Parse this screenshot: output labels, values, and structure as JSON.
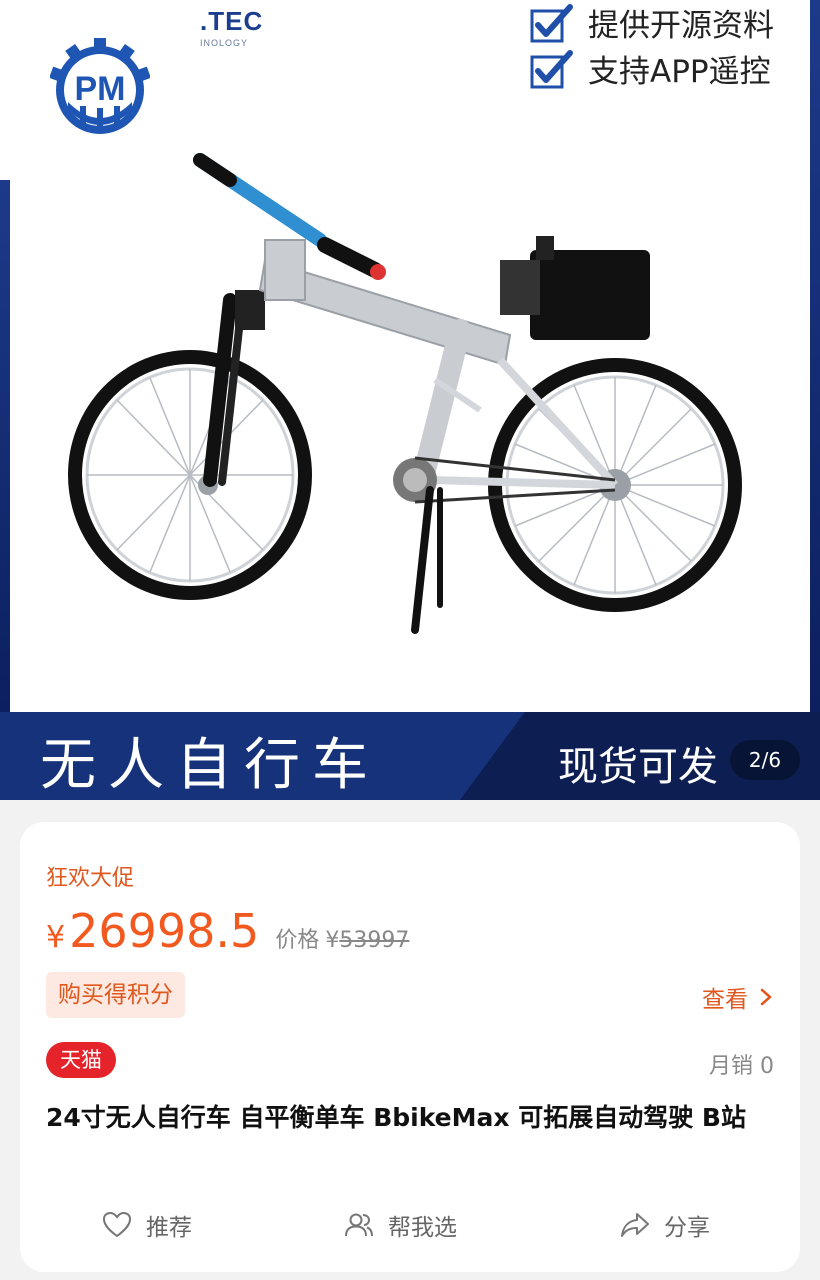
{
  "hero": {
    "brand_logo_text": "PM",
    "brand_text": ".TEC",
    "brand_subtext": "INOLOGY",
    "features": [
      {
        "label": "提供开源资料",
        "icon": "checkbox-checked-icon"
      },
      {
        "label": "支持APP遥控",
        "icon": "checkbox-checked-icon"
      }
    ],
    "banner_title": "无人自行车",
    "banner_subtitle": "现货可发",
    "page_counter": "2/6"
  },
  "product": {
    "promo_label": "狂欢大促",
    "currency_symbol": "¥",
    "price": "26998.5",
    "original_price_label": "价格",
    "original_price_symbol": "¥",
    "original_price": "53997",
    "points_badge": "购买得积分",
    "view_link": "查看",
    "store_badge": "天猫",
    "monthly_sales": "月销 0",
    "title": "24寸无人自行车  自平衡单车 BbikeMax 可拓展自动驾驶 B站"
  },
  "actions": [
    {
      "label": "推荐",
      "icon": "heart-icon"
    },
    {
      "label": "帮我选",
      "icon": "users-icon"
    },
    {
      "label": "分享",
      "icon": "share-icon"
    }
  ],
  "colors": {
    "accent": "#f2591f",
    "banner_blue": "#16327a",
    "tmall_red": "#e5232b",
    "checkbox_blue": "#1f4fa8"
  }
}
